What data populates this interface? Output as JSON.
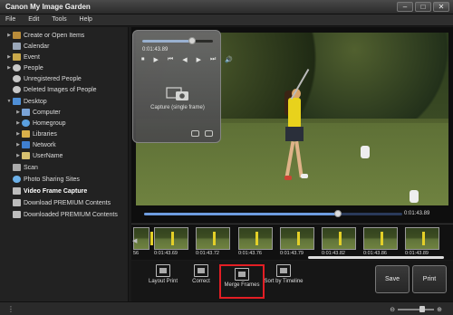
{
  "window": {
    "title": "Canon My Image Garden",
    "controls": {
      "minimize": "–",
      "maximize": "□",
      "close": "✕"
    }
  },
  "menu": [
    "File",
    "Edit",
    "Tools",
    "Help"
  ],
  "sidebar": {
    "items": [
      {
        "label": "Create or Open Items",
        "icon": "folder-icon",
        "expandable": true
      },
      {
        "label": "Calendar",
        "icon": "calendar-icon",
        "expandable": false
      },
      {
        "label": "Event",
        "icon": "event-icon",
        "expandable": true
      },
      {
        "label": "People",
        "icon": "person-icon",
        "expandable": true
      },
      {
        "label": "Unregistered People",
        "icon": "person-icon",
        "expandable": false
      },
      {
        "label": "Deleted Images of People",
        "icon": "person-icon",
        "expandable": false
      },
      {
        "label": "Desktop",
        "icon": "desktop-icon",
        "expandable": true
      },
      {
        "label": "Computer",
        "icon": "computer-icon",
        "expandable": true
      },
      {
        "label": "Homegroup",
        "icon": "homegroup-icon",
        "expandable": true
      },
      {
        "label": "Libraries",
        "icon": "libraries-icon",
        "expandable": true
      },
      {
        "label": "Network",
        "icon": "network-icon",
        "expandable": true
      },
      {
        "label": "UserName",
        "icon": "user-folder-icon",
        "expandable": true
      },
      {
        "label": "Scan",
        "icon": "scan-icon",
        "expandable": false
      },
      {
        "label": "Photo Sharing Sites",
        "icon": "globe-icon",
        "expandable": false
      },
      {
        "label": "Video Frame Capture",
        "icon": "video-icon",
        "expandable": false,
        "selected": true
      },
      {
        "label": "Download PREMIUM Contents",
        "icon": "download-icon",
        "expandable": false
      },
      {
        "label": "Downloaded PREMIUM Contents",
        "icon": "download-icon",
        "expandable": false
      }
    ]
  },
  "capture_panel": {
    "time": "0:01:43.89",
    "controls": [
      "⏹",
      "▶",
      "⏮",
      "◀",
      "▶",
      "⏭",
      "🔊"
    ],
    "caption": "Capture (single frame)",
    "progress": 0.7
  },
  "playback": {
    "current_time": "0:01:43.89",
    "progress": 0.75
  },
  "filmstrip": {
    "partial_label": "56",
    "frames": [
      "0:01:43.69",
      "0:01:43.72",
      "0:01:43.76",
      "0:01:43.79",
      "0:01:43.82",
      "0:01:43.86",
      "0:01:43.89"
    ]
  },
  "toolbar": {
    "tools": [
      {
        "label": "Layout Print",
        "icon": "layout-print-icon"
      },
      {
        "label": "Correct",
        "icon": "correct-icon"
      },
      {
        "label": "Merge Frames",
        "icon": "merge-frames-icon",
        "highlighted": true
      },
      {
        "label": "Sort by Timeline",
        "icon": "sort-timeline-icon"
      }
    ],
    "save_label": "Save",
    "print_label": "Print"
  },
  "status": {
    "menu_dots": "⋮"
  },
  "colors": {
    "highlight": "#e31e24",
    "accent": "#6f9de0"
  }
}
